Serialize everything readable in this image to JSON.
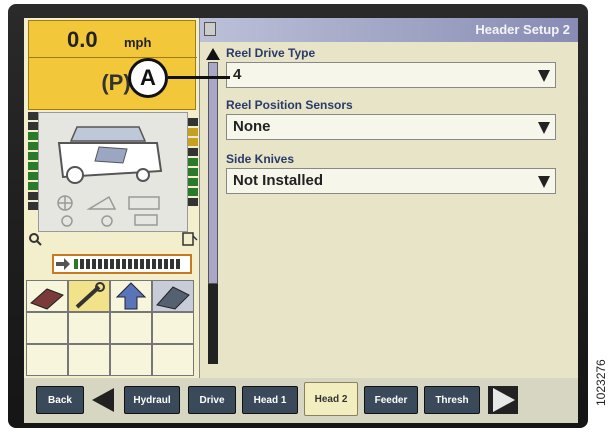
{
  "status": {
    "speed": "0.0",
    "speed_unit": "mph",
    "park": "P"
  },
  "icons": {
    "header": "menu-icon",
    "combine": "combine-harvester-icon",
    "tiles": [
      "header-icon",
      "wrench-icon",
      "up-arrow-icon",
      "field-icon"
    ]
  },
  "header": {
    "title": "Header Setup 2"
  },
  "fields": [
    {
      "label": "Reel Drive Type",
      "value": "4"
    },
    {
      "label": "Reel Position Sensors",
      "value": "None"
    },
    {
      "label": "Side Knives",
      "value": "Not Installed"
    }
  ],
  "bottom_bar": {
    "back": "Back",
    "tabs": [
      "Hydraul",
      "Drive",
      "Head 1",
      "Head 2",
      "Feeder",
      "Thresh"
    ],
    "active_tab": "Head 2"
  },
  "callout": {
    "label": "A"
  },
  "figure_id": "1023276",
  "colors": {
    "status_panel": "#f2c83a",
    "header_bar": "#888cb4",
    "screen_bg": "#e8e4c8",
    "tab_bg": "#3a4a5a",
    "tab_active_bg": "#f2eec0"
  }
}
